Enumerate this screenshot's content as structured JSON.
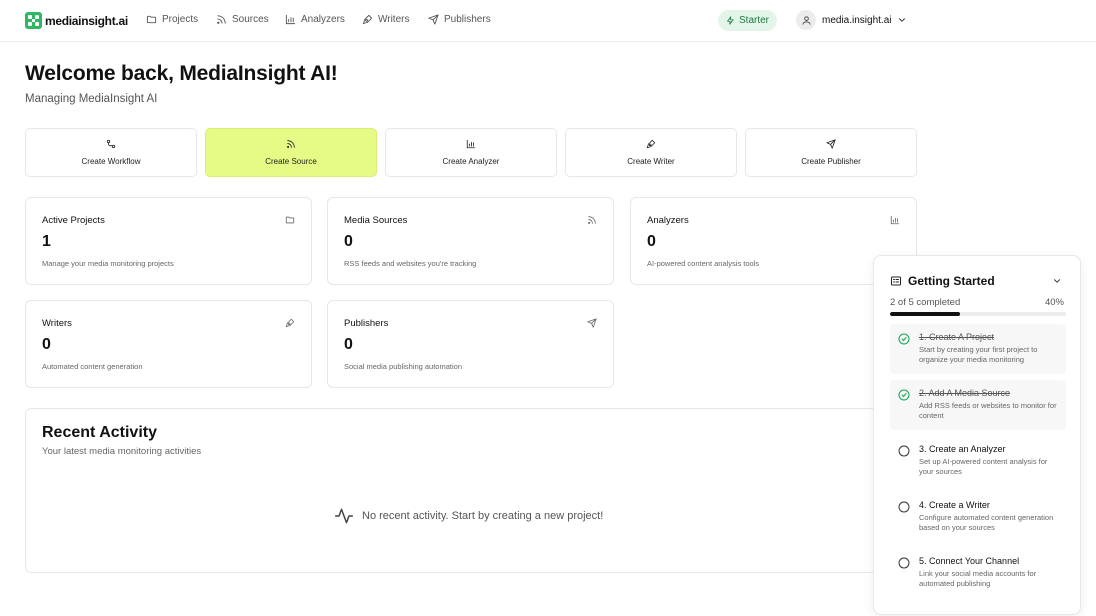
{
  "brand": {
    "name": "mediainsight.ai",
    "accent": "#e6fa86",
    "logo_color": "#2fb864"
  },
  "nav": {
    "items": [
      {
        "label": "Projects",
        "icon": "folder-icon"
      },
      {
        "label": "Sources",
        "icon": "rss-icon"
      },
      {
        "label": "Analyzers",
        "icon": "bar-chart-icon"
      },
      {
        "label": "Writers",
        "icon": "pen-tool-icon"
      },
      {
        "label": "Publishers",
        "icon": "send-icon"
      }
    ],
    "plan": "Starter",
    "user": "media.insight.ai"
  },
  "header": {
    "title": "Welcome back, MediaInsight AI!",
    "subtitle": "Managing MediaInsight AI"
  },
  "quick_actions": [
    {
      "label": "Create Workflow",
      "icon": "workflow-icon"
    },
    {
      "label": "Create Source",
      "icon": "rss-icon",
      "active": true
    },
    {
      "label": "Create Analyzer",
      "icon": "bar-chart-icon"
    },
    {
      "label": "Create Writer",
      "icon": "pen-tool-icon"
    },
    {
      "label": "Create Publisher",
      "icon": "send-icon"
    }
  ],
  "stats": [
    {
      "title": "Active Projects",
      "value": "1",
      "desc": "Manage your media monitoring projects",
      "icon": "folder-icon"
    },
    {
      "title": "Media Sources",
      "value": "0",
      "desc": "RSS feeds and websites you're tracking",
      "icon": "rss-icon"
    },
    {
      "title": "Analyzers",
      "value": "0",
      "desc": "AI-powered content analysis tools",
      "icon": "bar-chart-icon"
    },
    {
      "title": "Writers",
      "value": "0",
      "desc": "Automated content generation",
      "icon": "pen-tool-icon"
    },
    {
      "title": "Publishers",
      "value": "0",
      "desc": "Social media publishing automation",
      "icon": "send-icon"
    }
  ],
  "recent": {
    "title": "Recent Activity",
    "subtitle": "Your latest media monitoring activities",
    "empty": "No recent activity. Start by creating a new project!"
  },
  "getting_started": {
    "title": "Getting Started",
    "progress_label": "2 of 5 completed",
    "progress_pct": "40%",
    "progress_value": 0.4,
    "steps": [
      {
        "title": "1. Create A Project",
        "desc": "Start by creating your first project to organize your media monitoring",
        "done": true
      },
      {
        "title": "2. Add A Media Source",
        "desc": "Add RSS feeds or websites to monitor for content",
        "done": true
      },
      {
        "title": "3. Create an Analyzer",
        "desc": "Set up AI-powered content analysis for your sources",
        "done": false
      },
      {
        "title": "4. Create a Writer",
        "desc": "Configure automated content generation based on your sources",
        "done": false
      },
      {
        "title": "5. Connect Your Channel",
        "desc": "Link your social media accounts for automated publishing",
        "done": false
      }
    ]
  }
}
